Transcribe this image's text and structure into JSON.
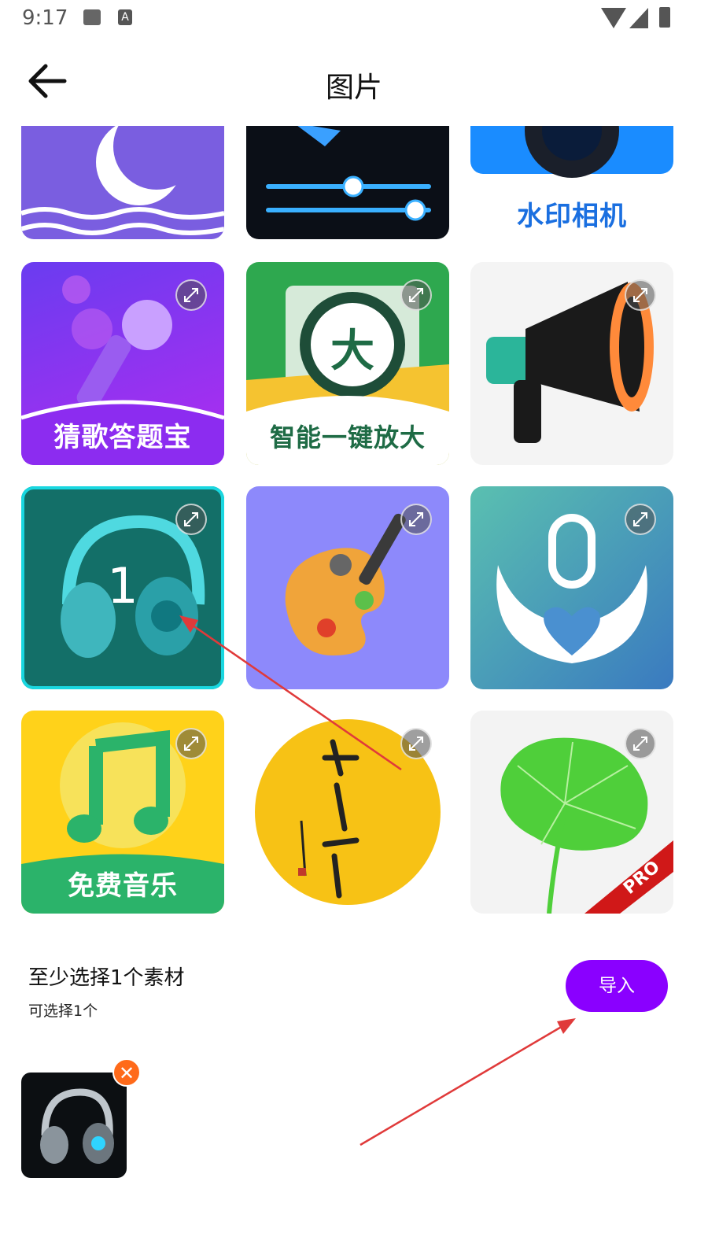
{
  "status_bar": {
    "time": "9:17",
    "icons": [
      "image-icon",
      "a-icon",
      "wifi-icon",
      "signal-icon",
      "battery-icon"
    ]
  },
  "header": {
    "title": "图片",
    "back_icon": "arrow-left-icon"
  },
  "tiles": [
    {
      "id": "moon",
      "caption": ""
    },
    {
      "id": "audio-sliders",
      "caption": ""
    },
    {
      "id": "watermark-camera",
      "caption": "水印相机"
    },
    {
      "id": "mic",
      "caption": "猜歌答题宝"
    },
    {
      "id": "magnify",
      "caption": "智能一键放大",
      "inner": "大"
    },
    {
      "id": "megaphone",
      "caption": ""
    },
    {
      "id": "headphones",
      "caption": "",
      "selected_index": "1"
    },
    {
      "id": "palette",
      "caption": ""
    },
    {
      "id": "mic-heart",
      "caption": ""
    },
    {
      "id": "music",
      "caption": "免费音乐"
    },
    {
      "id": "calligraphy",
      "caption": ""
    },
    {
      "id": "lotus",
      "caption": "",
      "badge": "PRO"
    }
  ],
  "selection": {
    "hint": "至少选择1个素材",
    "subhint": "可选择1个",
    "import_label": "导入",
    "remove_icon": "close-icon",
    "remove_glyph": "✕"
  },
  "colors": {
    "accent": "#8a00ff",
    "selected_border": "#19d7e0",
    "remove": "#ff6a1a"
  }
}
